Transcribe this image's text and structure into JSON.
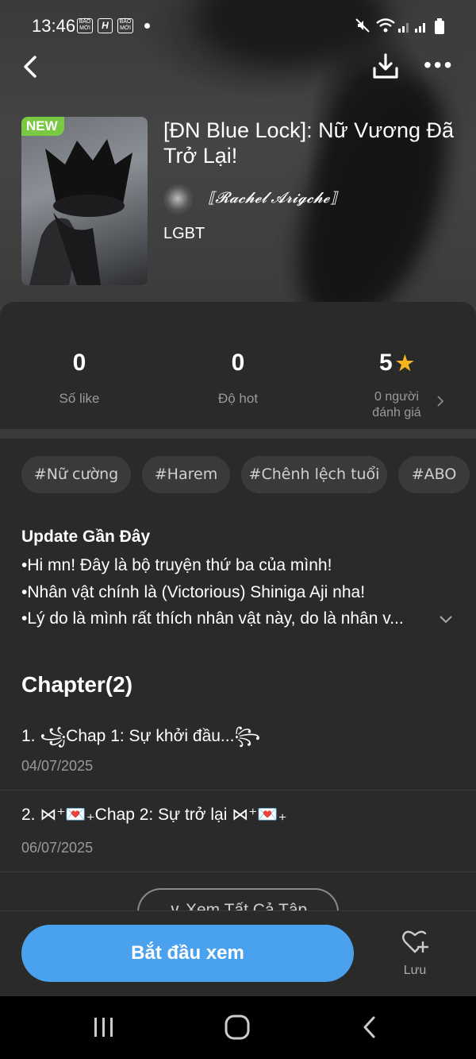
{
  "status_bar": {
    "time": "13:46",
    "icons": [
      "bao-moi-icon",
      "h-icon",
      "bao-moi-icon",
      "notification-dot",
      "mute-icon",
      "wifi-icon",
      "signal-icon",
      "signal-icon",
      "battery-icon"
    ]
  },
  "book": {
    "badge": "NEW",
    "title": "[ĐN Blue Lock]: Nữ Vương Đã Trở Lại!",
    "author": "⟦𝓡𝓪𝓬𝓱𝓮𝓵 𝓐𝓻𝓲𝓰𝓬𝓱𝓮⟧",
    "genre": "LGBT"
  },
  "stats": {
    "likes": {
      "value": "0",
      "label": "Số like"
    },
    "hot": {
      "value": "0",
      "label": "Độ hot"
    },
    "rating": {
      "value": "5",
      "label_line1": "0 người",
      "label_line2": "đánh giá"
    }
  },
  "tags": [
    "#Nữ cường",
    "#Harem",
    "#Chênh lệch tuổi",
    "#ABO"
  ],
  "update": {
    "title": "Update Gần Đây",
    "lines": [
      "•Hi mn! Đây là bộ truyện thứ ba của mình!",
      "•Nhân vật chính là (Victorious) Shiniga Aji nha!",
      "•Lý do là mình rất thích nhân vật này, do là nhân v..."
    ]
  },
  "chapters": {
    "heading": "Chapter(2)",
    "items": [
      {
        "title": "1. ꧁Chap 1: Sự khởi đầu...꧂",
        "date": "04/07/2025"
      },
      {
        "title": "2. ⋈⁺💌₊Chap 2: Sự trở lại ⋈⁺💌₊",
        "date": "06/07/2025"
      }
    ],
    "see_all": "∨ Xem Tất Cả Tập"
  },
  "actions": {
    "start": "Bắt đầu xem",
    "save": "Lưu"
  },
  "colors": {
    "accent": "#4aa2ee",
    "new_badge": "#7ac943",
    "star": "#f6b51e",
    "background": "#2a2a2a"
  }
}
